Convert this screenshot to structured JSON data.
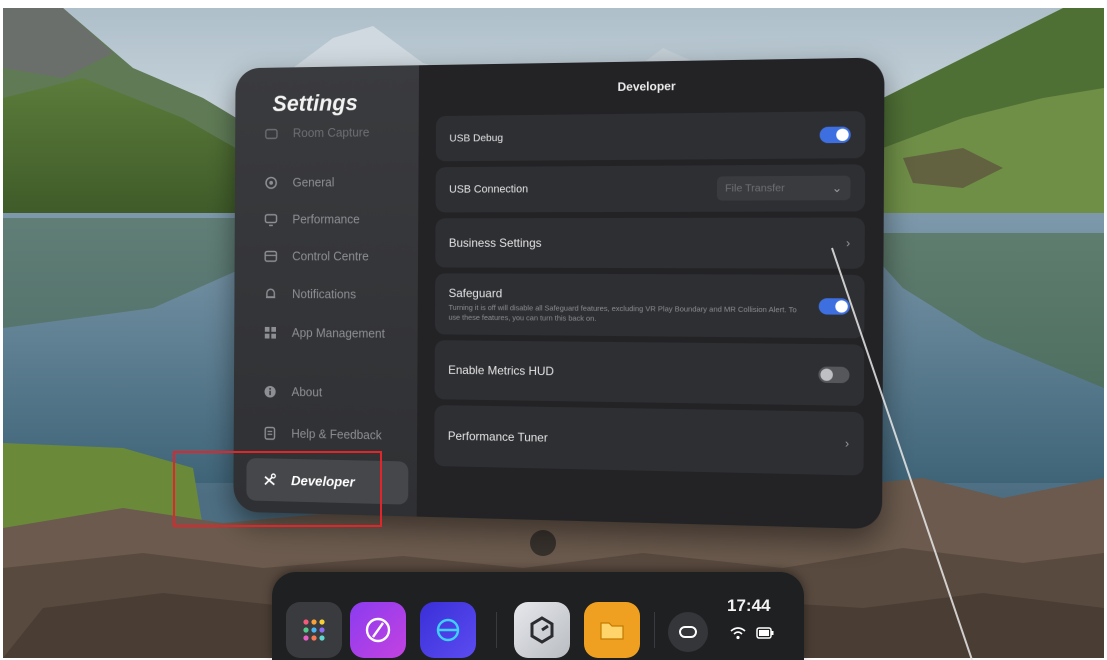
{
  "settings": {
    "title": "Settings",
    "page_title": "Developer",
    "sidebar": {
      "items": [
        {
          "label": "Room Capture",
          "icon": "room-capture-icon"
        },
        {
          "label": "General",
          "icon": "gear-icon"
        },
        {
          "label": "Performance",
          "icon": "performance-icon"
        },
        {
          "label": "Control Centre",
          "icon": "control-centre-icon"
        },
        {
          "label": "Notifications",
          "icon": "bell-icon"
        },
        {
          "label": "App Management",
          "icon": "apps-grid-icon"
        },
        {
          "label": "About",
          "icon": "info-icon"
        },
        {
          "label": "Help & Feedback",
          "icon": "help-icon"
        },
        {
          "label": "Developer",
          "icon": "tools-icon"
        }
      ]
    },
    "rows": {
      "usb_debug": {
        "label": "USB Debug",
        "enabled": true
      },
      "usb_connection": {
        "label": "USB Connection",
        "value": "File Transfer"
      },
      "business_settings": {
        "label": "Business Settings"
      },
      "safeguard": {
        "label": "Safeguard",
        "description": "Turning it is off will disable all Safeguard features, excluding VR Play Boundary and MR Collision Alert. To use these features, you can turn this back on.",
        "enabled": true
      },
      "metrics_hud": {
        "label": "Enable Metrics HUD",
        "enabled": false
      },
      "performance_tuner": {
        "label": "Performance Tuner"
      }
    }
  },
  "dock": {
    "apps": [
      {
        "name": "app-library",
        "icon": "grid-dots-icon"
      },
      {
        "name": "browser-purple",
        "icon": "compass-icon"
      },
      {
        "name": "browser-blue",
        "icon": "browser-icon"
      },
      {
        "name": "store",
        "icon": "hexagon-icon"
      },
      {
        "name": "files",
        "icon": "folder-icon"
      },
      {
        "name": "headset",
        "icon": "headset-icon"
      }
    ],
    "time": "17:44",
    "status": [
      "wifi-icon",
      "battery-icon"
    ]
  },
  "colors": {
    "accent_toggle": "#3d6fe0",
    "highlight": "#e0262b",
    "panel": "#232326",
    "sidebar": "#333437"
  }
}
